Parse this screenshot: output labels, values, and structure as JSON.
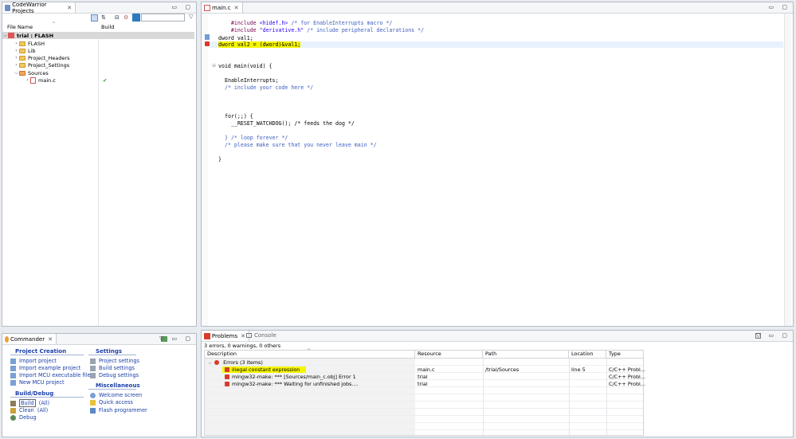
{
  "projects_panel": {
    "tab_title": "CodeWarrior Projects",
    "col_file": "File Name",
    "col_build": "Build",
    "tree": [
      {
        "label": "trial : FLASH",
        "bold": true
      },
      {
        "label": "FLASH"
      },
      {
        "label": "Lib"
      },
      {
        "label": "Project_Headers"
      },
      {
        "label": "Project_Settings"
      },
      {
        "label": "Sources"
      },
      {
        "label": "main.c",
        "build": "✔"
      }
    ]
  },
  "editor": {
    "tab_title": "main.c",
    "lines": [
      {
        "a": "#include ",
        "b": "<hidef.h>",
        "c": " /* for EnableInterrupts macro */"
      },
      {
        "a": "#include ",
        "b": "\"derivative.h\"",
        "c": " /* include peripheral declarations */"
      },
      {
        "t": "dword val1;"
      },
      {
        "t": "dword val2 = (dword)&val1;"
      },
      {
        "t": "void main(void) {"
      },
      {
        "t": "EnableInterrupts;"
      },
      {
        "t": "/* include your code here */"
      },
      {
        "t": "for(;;) {"
      },
      {
        "t": "__RESET_WATCHDOG(); /* feeds the dog */"
      },
      {
        "t": "} /* loop forever */"
      },
      {
        "t": "/* please make sure that you never leave main */"
      },
      {
        "t": "}"
      }
    ]
  },
  "commander": {
    "tab_title": "Commander",
    "sections": {
      "project_creation": "Project Creation",
      "settings": "Settings",
      "build_debug": "Build/Debug",
      "misc": "Miscellaneous"
    },
    "project_creation_items": [
      "Import project",
      "Import example project",
      "Import MCU executable file",
      "New MCU project"
    ],
    "settings_items": [
      "Project settings",
      "Build settings",
      "Debug settings"
    ],
    "misc_items": [
      "Welcome screen",
      "Quick access",
      "Flash programmer"
    ],
    "build_debug_items": [
      "Build",
      "Clean",
      "Debug"
    ],
    "all_label": "(All)"
  },
  "problems": {
    "tab_title": "Problems",
    "console_tab": "Console",
    "summary": "3 errors, 0 warnings, 0 others",
    "columns": [
      "Description",
      "Resource",
      "Path",
      "Location",
      "Type"
    ],
    "group": "Errors (3 items)",
    "rows": [
      {
        "desc": "illegal constant expression",
        "resource": "main.c",
        "path": "/trial/Sources",
        "location": "line 5",
        "type": "C/C++ Probl..."
      },
      {
        "desc": "mingw32-make: *** [Sources/main_c.obj] Error 1",
        "resource": "trial",
        "path": "",
        "location": "",
        "type": "C/C++ Probl..."
      },
      {
        "desc": "mingw32-make: *** Waiting for unfinished jobs....",
        "resource": "trial",
        "path": "",
        "location": "",
        "type": "C/C++ Probl..."
      }
    ]
  },
  "colors": {
    "highlight": "#f5f500",
    "link": "#1b3fa8",
    "error": "#d93b2b"
  }
}
